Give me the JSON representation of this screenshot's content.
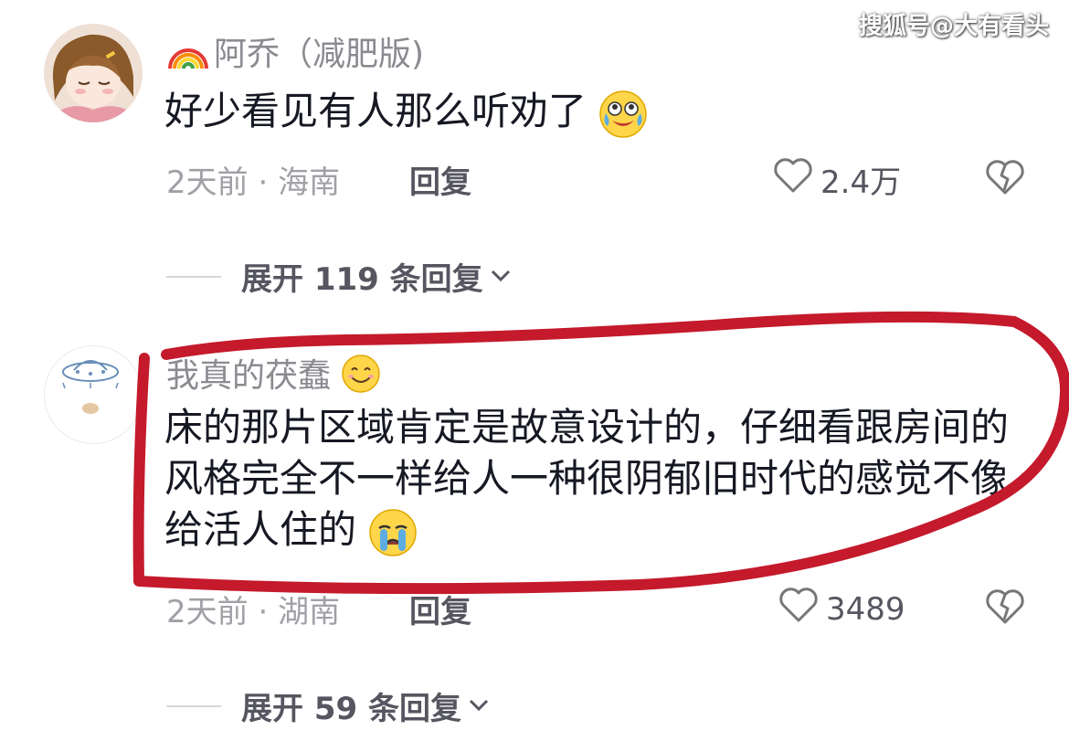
{
  "watermark": "搜狐号@大有看头",
  "comments": [
    {
      "username": "阿乔（减肥版)",
      "badge_icon": "rainbow-icon",
      "text": "好少看见有人那么听劝了",
      "emoji_icon": "tearful-laugh-emoji-icon",
      "time": "2天前",
      "location": "海南",
      "meta_separator": "·",
      "reply_label": "回复",
      "likes": "2.4万",
      "expand_label": "展开 119 条回复"
    },
    {
      "username": "我真的茯蠢",
      "badge_icon": "smile-emoji-icon",
      "text": "床的那片区域肯定是故意设计的，仔细看跟房间的风格完全不一样给人一种很阴郁旧时代的感觉不像给活人住的",
      "emoji_icon": "crying-emoji-icon",
      "time": "2天前",
      "location": "湖南",
      "meta_separator": "·",
      "reply_label": "回复",
      "likes": "3489",
      "expand_label": "展开 59 条回复"
    }
  ],
  "colors": {
    "annotation": "#c41a2c",
    "text_primary": "#161823",
    "text_secondary": "#8a8b91"
  }
}
